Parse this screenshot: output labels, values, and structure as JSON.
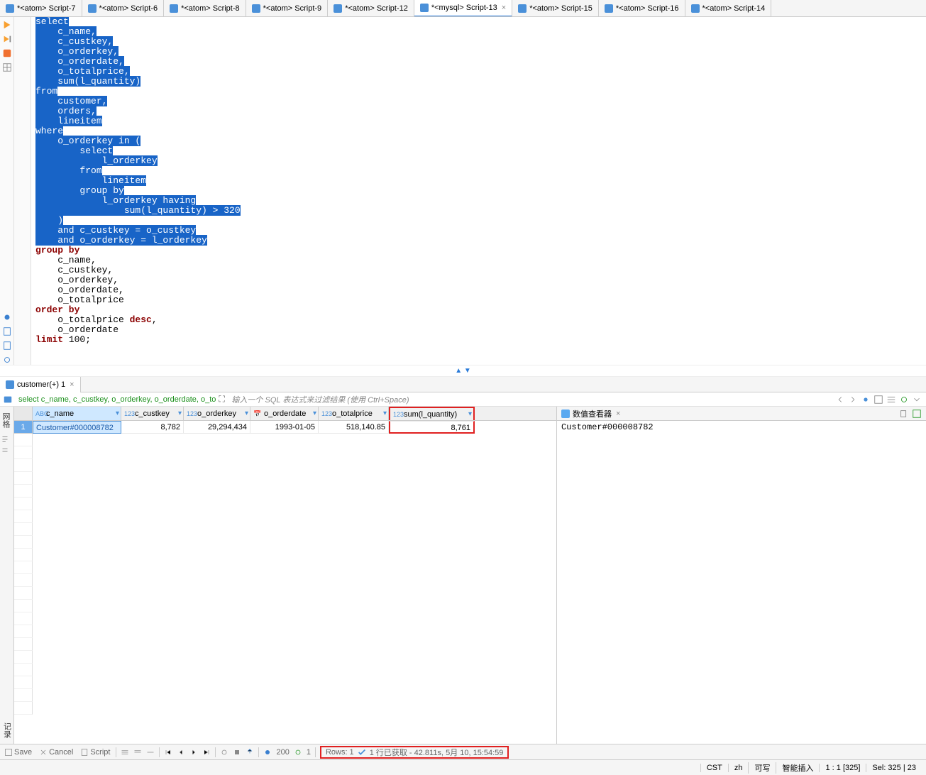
{
  "tabs": [
    {
      "label": "*<atom> Script-7"
    },
    {
      "label": "*<atom> Script-6"
    },
    {
      "label": "*<atom> Script-8"
    },
    {
      "label": "*<atom> Script-9"
    },
    {
      "label": "*<atom> Script-12"
    },
    {
      "label": "*<mysql> Script-13",
      "active": true
    },
    {
      "label": "*<atom> Script-15"
    },
    {
      "label": "*<atom> Script-16"
    },
    {
      "label": "*<atom> Script-14"
    }
  ],
  "code": {
    "selected_lines": [
      "select",
      "    c_name,",
      "    c_custkey,",
      "    o_orderkey,",
      "    o_orderdate,",
      "    o_totalprice,",
      "    sum(l_quantity)",
      "from",
      "    customer,",
      "    orders,",
      "    lineitem",
      "where",
      "    o_orderkey in (",
      "        select",
      "            l_orderkey",
      "        from",
      "            lineitem",
      "        group by",
      "            l_orderkey having",
      "                sum(l_quantity) > 320",
      "    )",
      "    and c_custkey = o_custkey",
      "    and o_orderkey = l_orderkey"
    ],
    "after": {
      "l0": "group by",
      "l1": "    c_name,",
      "l2": "    c_custkey,",
      "l3": "    o_orderkey,",
      "l4": "    o_orderdate,",
      "l5": "    o_totalprice",
      "l6a": "order by",
      "l7a": "    o_totalprice ",
      "l7b": "desc",
      "l7c": ",",
      "l8": "    o_orderdate",
      "l9a": "limit",
      "l9b": " 100;"
    }
  },
  "results_tab": {
    "label": "customer(+) 1"
  },
  "filter": {
    "query": "select c_name, c_custkey, o_orderkey, o_orderdate, o_to",
    "placeholder": "输入一个 SQL 表达式来过滤结果 (使用 Ctrl+Space)"
  },
  "side": {
    "top": "网格",
    "bottom": "记录"
  },
  "columns": {
    "c1": "c_name",
    "c2": "c_custkey",
    "c3": "o_orderkey",
    "c4": "o_orderdate",
    "c5": "o_totalprice",
    "c6": "sum(l_quantity)"
  },
  "row": {
    "num": "1",
    "c1": "Customer#000008782",
    "c2": "8,782",
    "c3": "29,294,434",
    "c4": "1993-01-05",
    "c5": "518,140.85",
    "c6": "8,761"
  },
  "viewer": {
    "title": "数值查看器",
    "content": "Customer#000008782"
  },
  "bottom": {
    "save": "Save",
    "cancel": "Cancel",
    "script": "Script",
    "fetch_size": "200",
    "page": "1",
    "rows_label": "Rows: 1",
    "status": "1 行已获取 - 42.811s, 5月 10, 15:54:59"
  },
  "status": {
    "s1": "CST",
    "s2": "zh",
    "s3": "可写",
    "s4": "智能插入",
    "s5": "1 : 1 [325]",
    "s6": "Sel: 325 | 23"
  }
}
